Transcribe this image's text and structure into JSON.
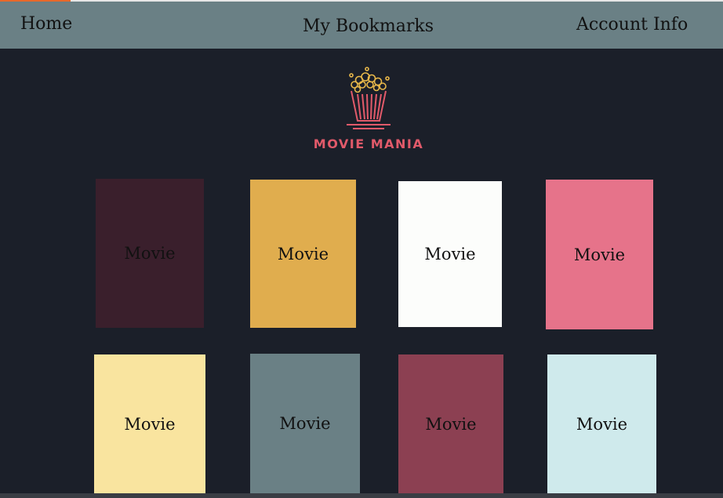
{
  "nav": {
    "home": "Home",
    "bookmarks": "My Bookmarks",
    "account": "Account Info"
  },
  "logo": {
    "text": "MOVIE MANIA",
    "icon": "popcorn-icon"
  },
  "colors": {
    "navbar": "#6a8085",
    "background": "#1b1f29",
    "logo_accent": "#e15a6a"
  },
  "movies": [
    {
      "label": "Movie",
      "color": "#3a1f2c"
    },
    {
      "label": "Movie",
      "color": "#e0ad4e"
    },
    {
      "label": "Movie",
      "color": "#fcfdfb"
    },
    {
      "label": "Movie",
      "color": "#e6738a"
    },
    {
      "label": "Movie",
      "color": "#f9e49f"
    },
    {
      "label": "Movie",
      "color": "#6a8085"
    },
    {
      "label": "Movie",
      "color": "#8c4052"
    },
    {
      "label": "Movie",
      "color": "#cfeaec"
    }
  ]
}
